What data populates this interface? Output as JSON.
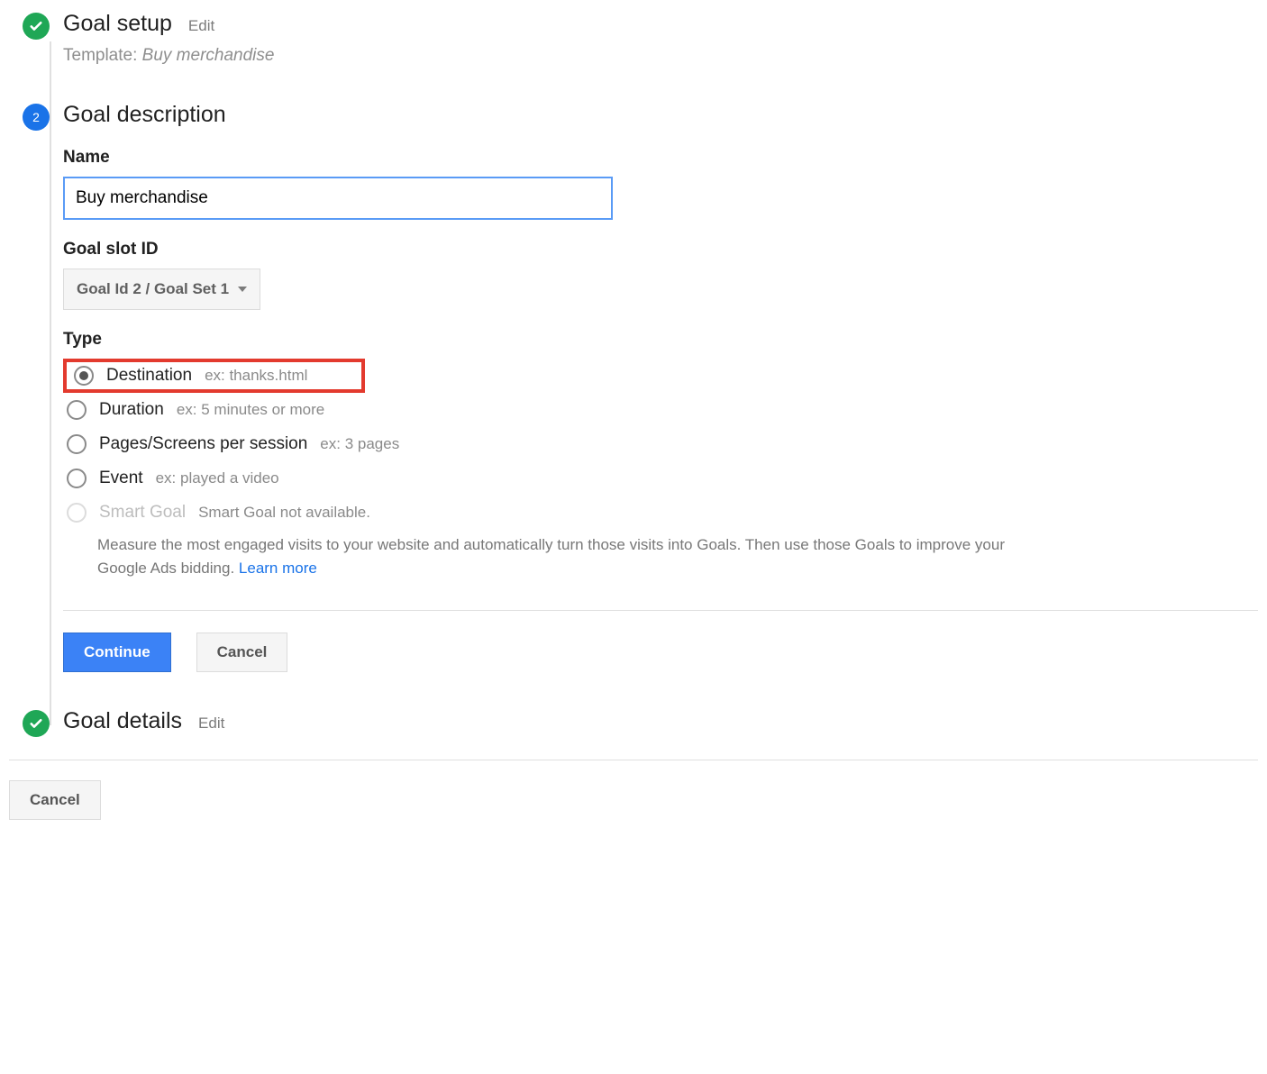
{
  "steps": {
    "setup": {
      "title": "Goal setup",
      "edit": "Edit",
      "template_prefix": "Template: ",
      "template_name": "Buy merchandise"
    },
    "description": {
      "number": "2",
      "title": "Goal description",
      "name_label": "Name",
      "name_value": "Buy merchandise",
      "slot_label": "Goal slot ID",
      "slot_value": "Goal Id 2 / Goal Set 1",
      "type_label": "Type",
      "types": {
        "destination": {
          "label": "Destination",
          "hint": "ex: thanks.html"
        },
        "duration": {
          "label": "Duration",
          "hint": "ex: 5 minutes or more"
        },
        "pages": {
          "label": "Pages/Screens per session",
          "hint": "ex: 3 pages"
        },
        "event": {
          "label": "Event",
          "hint": "ex: played a video"
        },
        "smart": {
          "label": "Smart Goal",
          "hint": "Smart Goal not available."
        }
      },
      "smart_desc_1": "Measure the most engaged visits to your website and automatically turn those visits into Goals. Then use those Goals to improve your Google Ads bidding. ",
      "smart_learn": "Learn more",
      "continue": "Continue",
      "cancel": "Cancel"
    },
    "details": {
      "title": "Goal details",
      "edit": "Edit"
    }
  },
  "footer": {
    "cancel": "Cancel"
  }
}
